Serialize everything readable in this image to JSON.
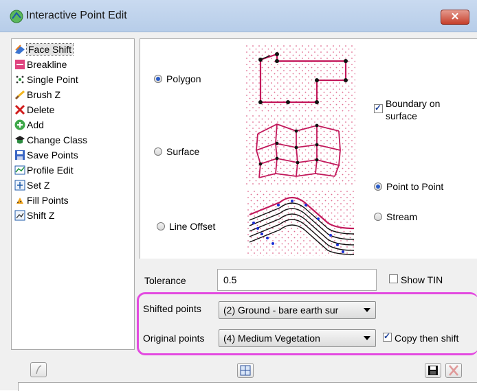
{
  "window": {
    "title": "Interactive Point Edit",
    "close_label": "✕"
  },
  "tools": [
    {
      "label": "Face Shift",
      "icon": "face-shift-icon",
      "selected": true
    },
    {
      "label": "Breakline",
      "icon": "breakline-icon"
    },
    {
      "label": "Single Point",
      "icon": "single-point-icon"
    },
    {
      "label": "Brush Z",
      "icon": "brush-icon"
    },
    {
      "label": "Delete",
      "icon": "delete-x-icon"
    },
    {
      "label": "Add",
      "icon": "add-plus-icon"
    },
    {
      "label": "Change Class",
      "icon": "graduation-cap-icon"
    },
    {
      "label": "Save Points",
      "icon": "save-disk-icon"
    },
    {
      "label": "Profile Edit",
      "icon": "profile-icon"
    },
    {
      "label": "Set Z",
      "icon": "set-z-icon"
    },
    {
      "label": "Fill Points",
      "icon": "fill-points-icon"
    },
    {
      "label": "Shift Z",
      "icon": "shift-z-icon"
    }
  ],
  "modes": {
    "polygon": "Polygon",
    "surface": "Surface",
    "line_offset": "Line Offset",
    "selected": "Polygon"
  },
  "boundary_on_surface": {
    "label_line1": "Boundary on",
    "label_line2": "surface",
    "checked": true
  },
  "line_mode": {
    "point_to_point": "Point to Point",
    "stream": "Stream",
    "selected": "Point to Point"
  },
  "tolerance": {
    "label": "Tolerance",
    "value": "0.5"
  },
  "show_tin": {
    "label": "Show TIN",
    "checked": false
  },
  "shifted_points": {
    "label": "Shifted points",
    "value": "(2) Ground - bare earth sur"
  },
  "original_points": {
    "label": "Original points",
    "value": "(4) Medium Vegetation"
  },
  "copy_then_shift": {
    "label": "Copy then shift",
    "checked": true
  },
  "colors": {
    "accent_highlight": "#e34ae0",
    "diagram_line": "#c2185b",
    "point_blue": "#1a2fd6"
  }
}
